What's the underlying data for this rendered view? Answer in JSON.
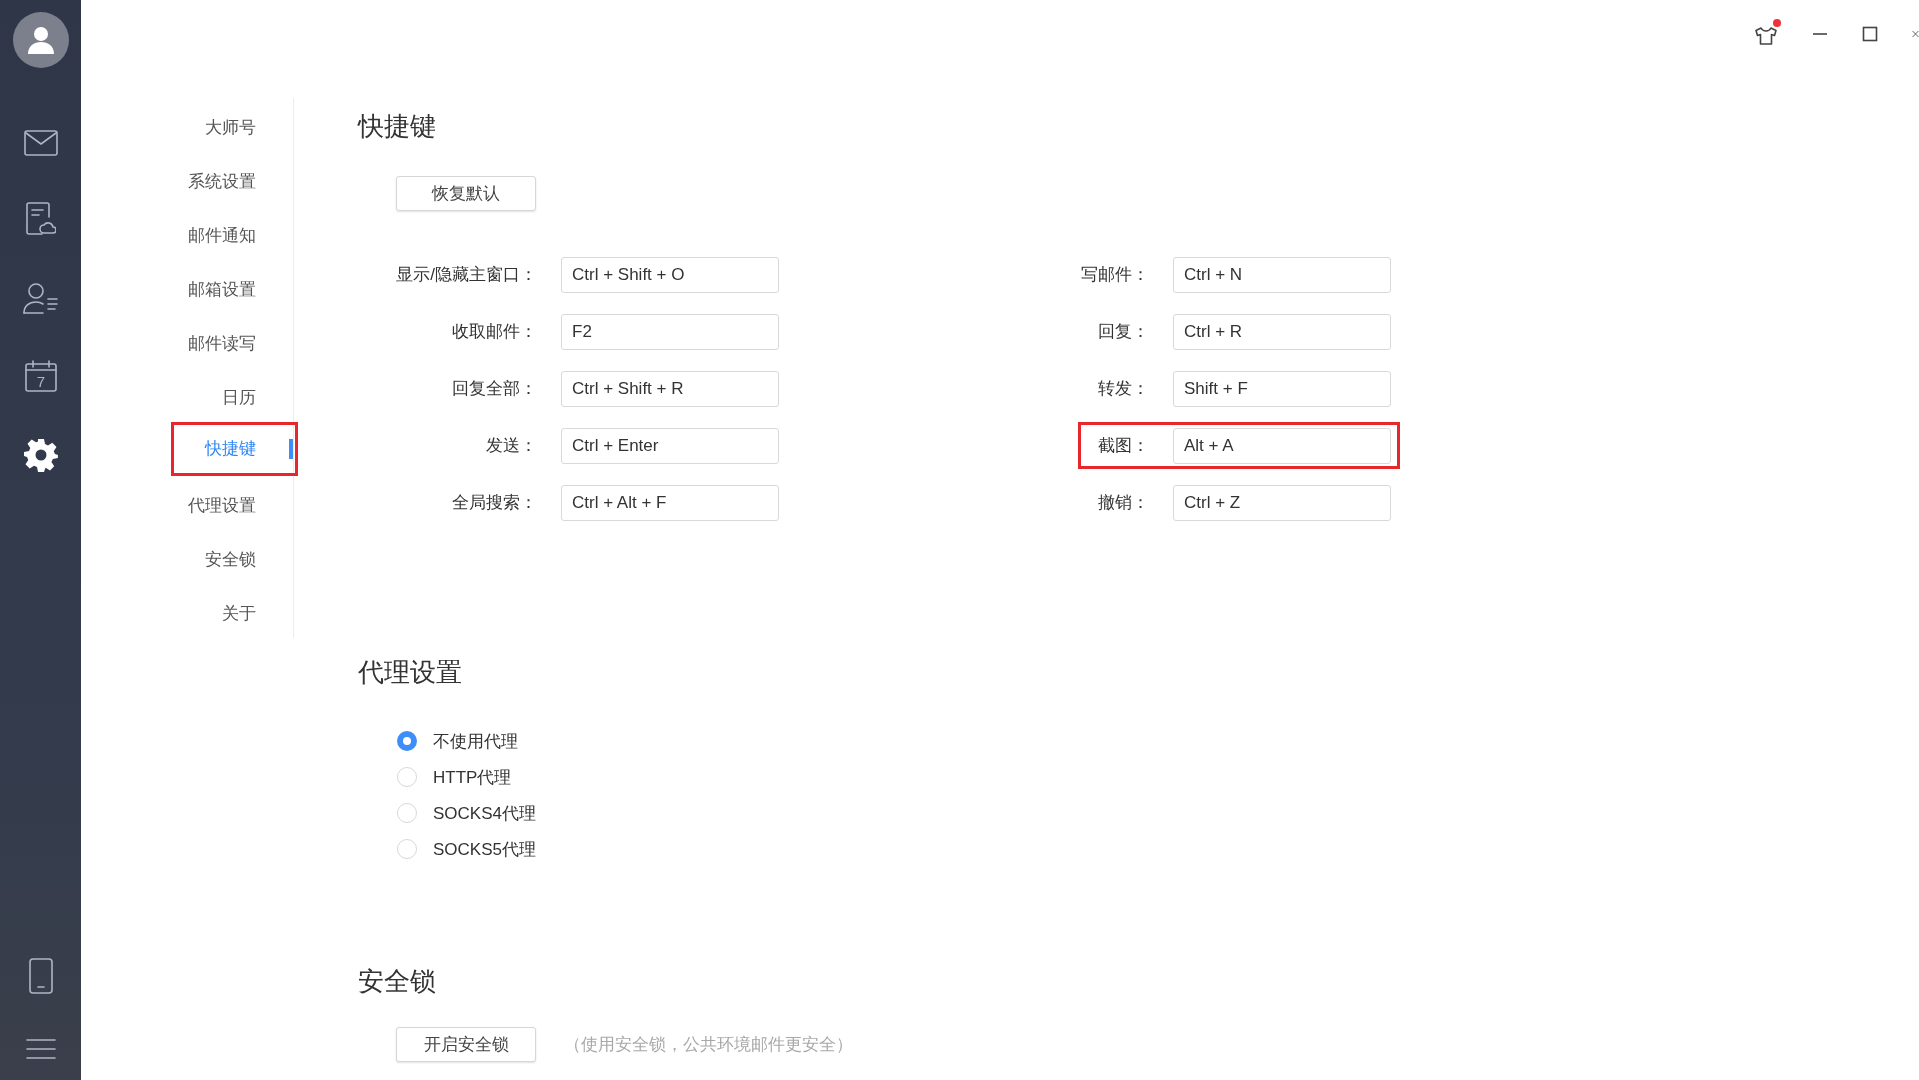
{
  "rail": {
    "items": [
      {
        "kind": "mail",
        "selected": false
      },
      {
        "kind": "cloud-doc",
        "selected": false
      },
      {
        "kind": "contacts",
        "selected": false
      },
      {
        "kind": "calendar",
        "selected": false,
        "day": "7"
      },
      {
        "kind": "settings",
        "selected": true
      }
    ],
    "bottom_items": [
      {
        "kind": "phone"
      },
      {
        "kind": "menu"
      }
    ]
  },
  "title_bar": {
    "skin_badge": true
  },
  "nav": {
    "items": [
      {
        "label": "大师号",
        "selected": false,
        "highlighted": false
      },
      {
        "label": "系统设置",
        "selected": false,
        "highlighted": false
      },
      {
        "label": "邮件通知",
        "selected": false,
        "highlighted": false
      },
      {
        "label": "邮箱设置",
        "selected": false,
        "highlighted": false
      },
      {
        "label": "邮件读写",
        "selected": false,
        "highlighted": false
      },
      {
        "label": "日历",
        "selected": false,
        "highlighted": false
      },
      {
        "label": "快捷键",
        "selected": true,
        "highlighted": true
      },
      {
        "label": "代理设置",
        "selected": false,
        "highlighted": false
      },
      {
        "label": "安全锁",
        "selected": false,
        "highlighted": false
      },
      {
        "label": "关于",
        "selected": false,
        "highlighted": false
      }
    ]
  },
  "shortcuts": {
    "title": "快捷键",
    "restore_button": "恢复默认",
    "columns": [
      [
        {
          "label": "显示/隐藏主窗口：",
          "value": "Ctrl + Shift + O",
          "highlighted": false
        },
        {
          "label": "收取邮件：",
          "value": "F2",
          "highlighted": false
        },
        {
          "label": "回复全部：",
          "value": "Ctrl + Shift + R",
          "highlighted": false
        },
        {
          "label": "发送：",
          "value": "Ctrl + Enter",
          "highlighted": false
        },
        {
          "label": "全局搜索：",
          "value": "Ctrl + Alt + F",
          "highlighted": false
        }
      ],
      [
        {
          "label": "写邮件：",
          "value": "Ctrl + N",
          "highlighted": false
        },
        {
          "label": "回复：",
          "value": "Ctrl + R",
          "highlighted": false
        },
        {
          "label": "转发：",
          "value": "Shift + F",
          "highlighted": false
        },
        {
          "label": "截图：",
          "value": "Alt + A",
          "highlighted": true
        },
        {
          "label": "撤销：",
          "value": "Ctrl + Z",
          "highlighted": false
        }
      ]
    ]
  },
  "proxy": {
    "title": "代理设置",
    "options": [
      {
        "label": "不使用代理",
        "selected": true
      },
      {
        "label": "HTTP代理",
        "selected": false
      },
      {
        "label": "SOCKS4代理",
        "selected": false
      },
      {
        "label": "SOCKS5代理",
        "selected": false
      }
    ]
  },
  "security": {
    "title": "安全锁",
    "button": "开启安全锁",
    "hint": "（使用安全锁，公共环境邮件更安全）"
  }
}
